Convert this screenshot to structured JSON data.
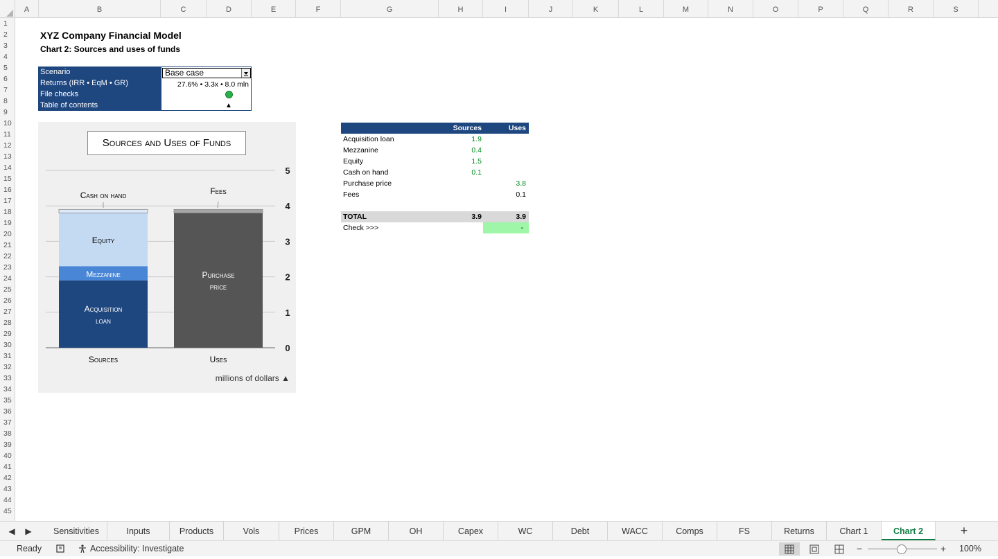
{
  "columns": [
    "A",
    "B",
    "C",
    "D",
    "E",
    "F",
    "G",
    "H",
    "I",
    "J",
    "K",
    "L",
    "M",
    "N",
    "O",
    "P",
    "Q",
    "R",
    "S"
  ],
  "rows": [
    "1",
    "2",
    "3",
    "4",
    "5",
    "6",
    "7",
    "8",
    "9",
    "10",
    "11",
    "12",
    "13",
    "14",
    "15",
    "16",
    "17",
    "18",
    "19",
    "20",
    "21",
    "22",
    "23",
    "24",
    "25",
    "26",
    "27",
    "28",
    "29",
    "30",
    "31",
    "32",
    "33",
    "34",
    "35",
    "36",
    "37",
    "38",
    "39",
    "40",
    "41",
    "42",
    "43",
    "44",
    "45"
  ],
  "sheet": {
    "title": "XYZ Company Financial Model",
    "subtitle": "Chart 2: Sources and uses of funds",
    "panel": {
      "labels": [
        "Scenario",
        "Returns (IRR • EqM • GR)",
        "File checks",
        "Table of contents"
      ],
      "scenario_value": "Base case",
      "returns_value": "27.6% • 3.3x • 8.0 mln",
      "toc_symbol": "▲"
    }
  },
  "chart_data": {
    "type": "bar",
    "stacked": true,
    "title": "Sources and Uses of Funds",
    "categories": [
      "Sources",
      "Uses"
    ],
    "series": [
      {
        "name": "Acquisition loan",
        "values": [
          1.9,
          0
        ],
        "color": "#1f477f"
      },
      {
        "name": "Mezzanine",
        "values": [
          0.4,
          0
        ],
        "color": "#4a86d6"
      },
      {
        "name": "Equity",
        "values": [
          1.5,
          0
        ],
        "color": "#c4d9f2"
      },
      {
        "name": "Cash on hand",
        "values": [
          0.1,
          0
        ],
        "color": "#dde9f8"
      },
      {
        "name": "Purchase price",
        "values": [
          0,
          3.8
        ],
        "color": "#555555"
      },
      {
        "name": "Fees",
        "values": [
          0,
          0.1
        ],
        "color": "#a6a6a6"
      }
    ],
    "ylim": [
      0,
      5
    ],
    "yticks": [
      "0",
      "1",
      "2",
      "3",
      "4",
      "5"
    ],
    "y_axis_side": "right",
    "grid": true,
    "unit_note": "millions of dollars ▲",
    "labels": {
      "cash_on_hand": "Cash on hand",
      "equity": "Equity",
      "mezzanine": "Mezzanine",
      "acquisition_loan": "Acquisition",
      "acquisition_loan_2": "loan",
      "fees": "Fees",
      "purchase_price": "Purchase",
      "purchase_price_2": "price",
      "sources": "Sources",
      "uses": "Uses"
    }
  },
  "su_table": {
    "headers": {
      "sources": "Sources",
      "uses": "Uses"
    },
    "rows": [
      {
        "label": "Acquisition loan",
        "sources": "1.9",
        "uses": ""
      },
      {
        "label": "Mezzanine",
        "sources": "0.4",
        "uses": ""
      },
      {
        "label": "Equity",
        "sources": "1.5",
        "uses": ""
      },
      {
        "label": "Cash on hand",
        "sources": "0.1",
        "uses": ""
      },
      {
        "label": "Purchase price",
        "sources": "",
        "uses": "3.8"
      },
      {
        "label": "Fees",
        "sources": "",
        "uses": "0.1"
      }
    ],
    "total": {
      "label": "TOTAL",
      "sources": "3.9",
      "uses": "3.9"
    },
    "check": {
      "label": "Check >>>",
      "value": "-"
    }
  },
  "tabs": [
    "Sensitivities",
    "Inputs",
    "Products",
    "Vols",
    "Prices",
    "GPM",
    "OH",
    "Capex",
    "WC",
    "Debt",
    "WACC",
    "Comps",
    "FS",
    "Returns",
    "Chart 1",
    "Chart 2"
  ],
  "active_tab": "Chart 2",
  "status": {
    "ready": "Ready",
    "accessibility": "Accessibility: Investigate",
    "zoom": "100%",
    "zoom_level_percent": 100
  }
}
